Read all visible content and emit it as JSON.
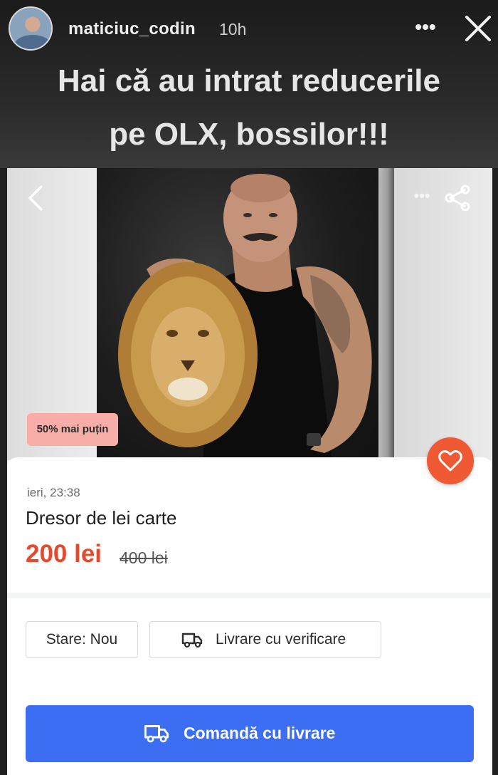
{
  "story": {
    "username": "maticiuc_codin",
    "time": "10h",
    "more_icon": "more-dots-icon",
    "close_icon": "close-icon",
    "caption_line1": "Hai că au intrat reducerile",
    "caption_line2": "pe OLX, bossilor!!!"
  },
  "listing": {
    "discount_badge": "50% mai puțin",
    "posted_time": "ieri, 23:38",
    "title": "Dresor de lei carte",
    "price": "200 lei",
    "old_price": "400 lei",
    "attributes": {
      "state": "Stare: Nou",
      "delivery": "Livrare cu verificare"
    },
    "order_button": "Comandă cu livrare",
    "colors": {
      "price": "#e64a2e",
      "favorite": "#ef5a34",
      "order_button": "#3c6ef3",
      "badge": "#f7aea8"
    },
    "icons": [
      "back-arrow-icon",
      "more-dots-icon",
      "share-icon",
      "heart-icon",
      "truck-icon"
    ]
  }
}
